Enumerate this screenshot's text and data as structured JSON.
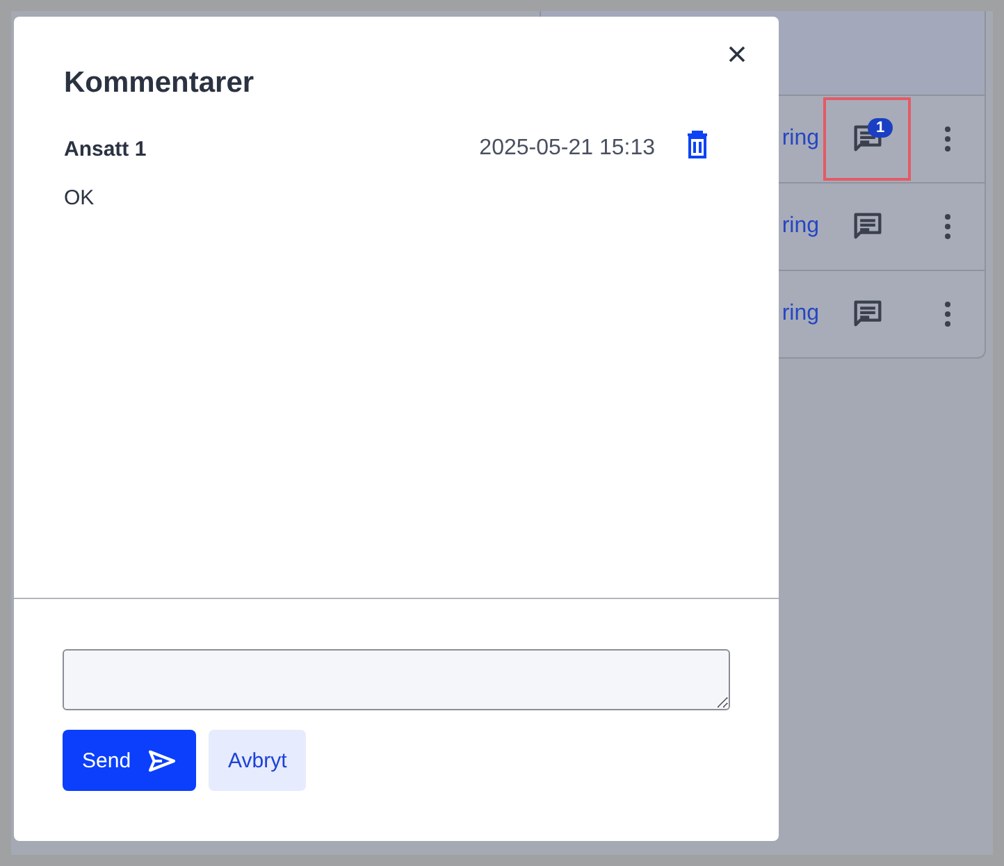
{
  "background_rows": [
    {
      "link": "ring",
      "badge": "1",
      "highlighted": true
    },
    {
      "link": "ring",
      "highlighted": false
    },
    {
      "link": "ring",
      "highlighted": false
    }
  ],
  "dialog": {
    "title": "Kommentarer",
    "comments": [
      {
        "author": "Ansatt 1",
        "time": "2025-05-21 15:13",
        "text": "OK"
      }
    ],
    "buttons": [
      {
        "kind": "primary",
        "label": "Send"
      },
      {
        "kind": "secondary",
        "label": "Avbryt"
      }
    ]
  }
}
